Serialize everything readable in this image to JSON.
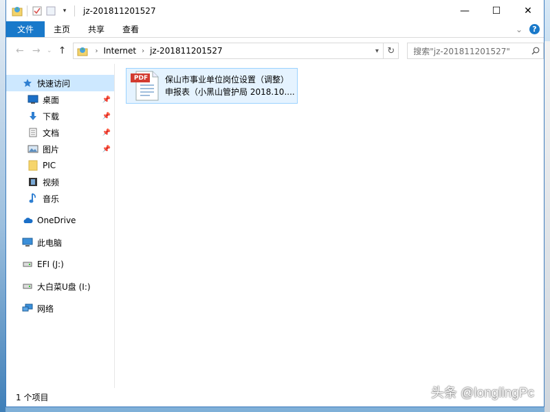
{
  "window": {
    "title": "jz-201811201527",
    "controls": {
      "minimize": "—",
      "maximize": "☐",
      "close": "✕"
    }
  },
  "ribbon": {
    "tabs": [
      "文件",
      "主页",
      "共享",
      "查看"
    ],
    "help": "?"
  },
  "address": {
    "crumbs": [
      "Internet",
      "jz-201811201527"
    ],
    "search_placeholder": "搜索\"jz-201811201527\""
  },
  "sidebar": {
    "quick_access": "快速访问",
    "pinned": [
      "桌面",
      "下载",
      "文档",
      "图片"
    ],
    "unpinned": [
      "PIC",
      "视频",
      "音乐"
    ],
    "onedrive": "OneDrive",
    "this_pc": "此电脑",
    "drives": [
      "EFI (J:)",
      "大白菜U盘 (I:)"
    ],
    "network": "网络"
  },
  "files": [
    {
      "name_line1": "保山市事业单位岗位设置（调整）",
      "name_line2": "申报表（小黑山管护局  2018.10....",
      "icon_label": "PDF"
    }
  ],
  "status": {
    "count": "1 个项目"
  },
  "watermark": "头条 @longlingPc",
  "colors": {
    "accent": "#1979ca",
    "selection": "#cde8ff",
    "item_hover": "#e5f3ff",
    "pdf_red": "#d23b2f"
  }
}
